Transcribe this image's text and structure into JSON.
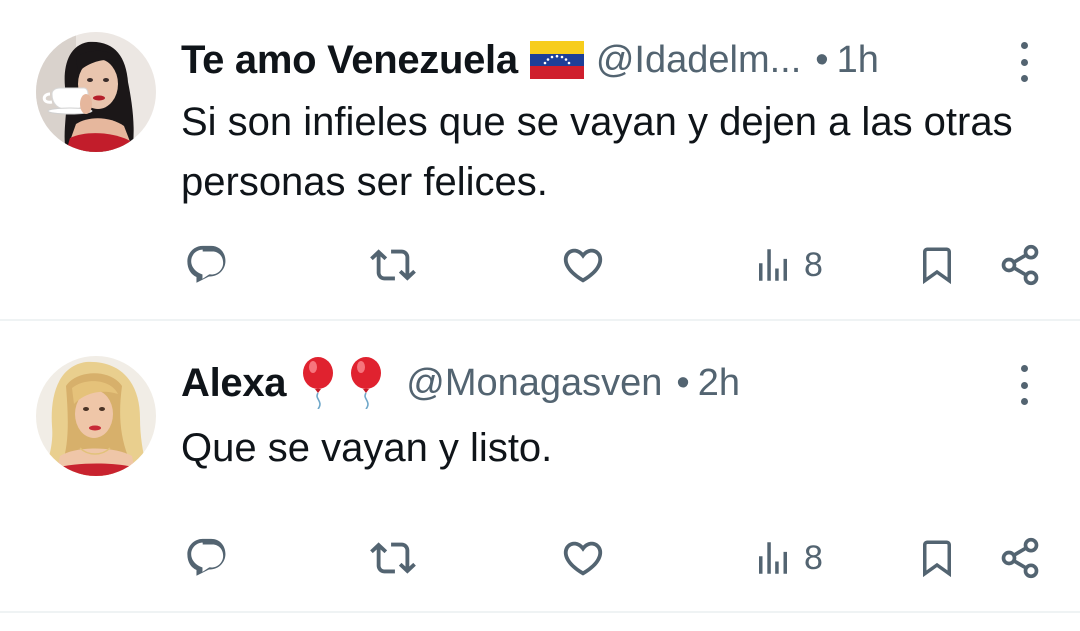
{
  "colors": {
    "text_primary": "#0f1419",
    "text_secondary": "#536471",
    "divider": "#eff3f4",
    "background": "#ffffff"
  },
  "tweets": [
    {
      "display_name": "Te amo Venezuela",
      "name_emoji": "venezuela-flag",
      "handle": "@Idadelm...",
      "separator": "•",
      "time": "1h",
      "text": "Si son infieles que se vayan y dejen a las otras personas ser felices.",
      "views": "8",
      "icons": [
        "reply-icon",
        "retweet-icon",
        "like-icon",
        "views-icon",
        "bookmark-icon",
        "share-icon"
      ]
    },
    {
      "display_name": "Alexa",
      "name_emoji": "red-balloons",
      "handle": "@Monagasven",
      "separator": "•",
      "time": "2h",
      "text": "Que se vayan y listo.",
      "views": "8",
      "icons": [
        "reply-icon",
        "retweet-icon",
        "like-icon",
        "views-icon",
        "bookmark-icon",
        "share-icon"
      ]
    }
  ]
}
